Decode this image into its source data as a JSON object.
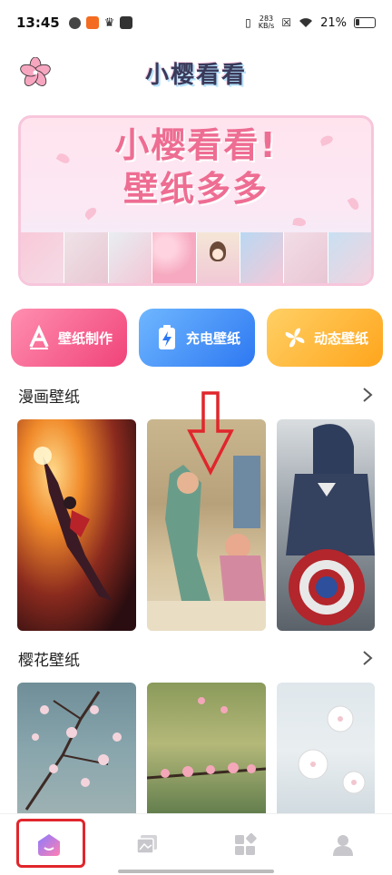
{
  "status_bar": {
    "time": "13:45",
    "net_speed_value": "283",
    "net_speed_unit": "KB/s",
    "battery": "21%"
  },
  "header": {
    "title": "小樱看看"
  },
  "banner": {
    "line1": "小樱看看!",
    "line2": "壁纸多多"
  },
  "categories": [
    {
      "label": "壁纸制作",
      "color": "#f0437a",
      "icon": "letter-a-icon"
    },
    {
      "label": "充电壁纸",
      "color": "#2d78f2",
      "icon": "battery-charge-icon"
    },
    {
      "label": "动态壁纸",
      "color": "#ffa51c",
      "icon": "pinwheel-icon"
    }
  ],
  "sections": [
    {
      "title": "漫画壁纸"
    },
    {
      "title": "樱花壁纸"
    }
  ],
  "bottom_nav": [
    {
      "name": "home",
      "icon": "home-icon",
      "active": true
    },
    {
      "name": "gallery",
      "icon": "gallery-icon",
      "active": false
    },
    {
      "name": "apps",
      "icon": "apps-icon",
      "active": false
    },
    {
      "name": "profile",
      "icon": "profile-icon",
      "active": false
    }
  ],
  "colors": {
    "accent_pink": "#ee6d92",
    "annotation_red": "#e0262c"
  }
}
